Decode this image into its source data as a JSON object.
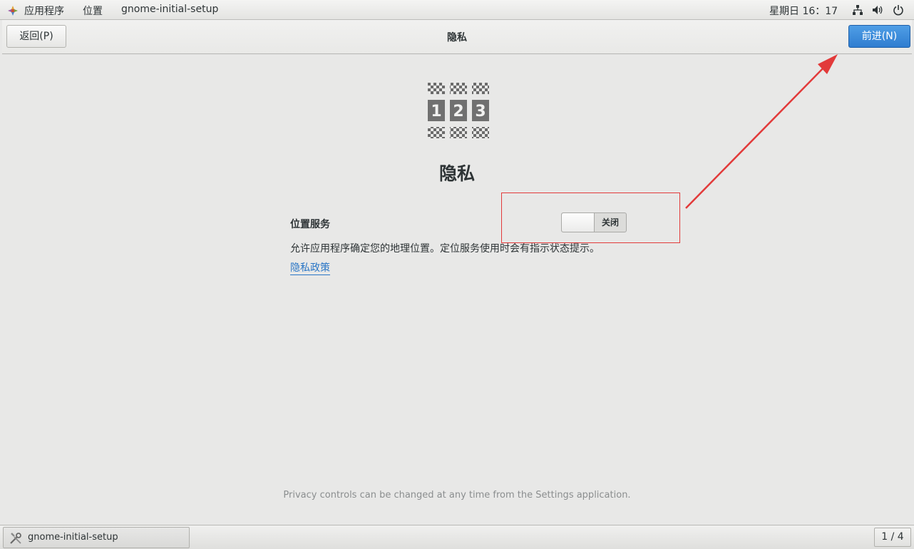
{
  "topbar": {
    "apps_menu": "应用程序",
    "places_menu": "位置",
    "window_title": "gnome-initial-setup",
    "clock": "星期日 16：17",
    "icons": [
      "network-icon",
      "volume-icon",
      "power-icon"
    ]
  },
  "headerbar": {
    "back_button": "返回(P)",
    "title": "隐私",
    "next_button": "前进(N)"
  },
  "main": {
    "heading": "隐私",
    "location_services_label": "位置服务",
    "location_switch_state": "关闭",
    "location_description": "允许应用程序确定您的地理位置。定位服务使用时会有指示状态提示。",
    "privacy_policy_link": "隐私政策",
    "footer_note": "Privacy controls can be changed at any time from the Settings application."
  },
  "taskbar": {
    "task_label": "gnome-initial-setup",
    "workspace_pager": "1 / 4"
  },
  "colors": {
    "accent": "#3584e4",
    "annotation": "#e23a3a",
    "background": "#e8e8e7"
  }
}
